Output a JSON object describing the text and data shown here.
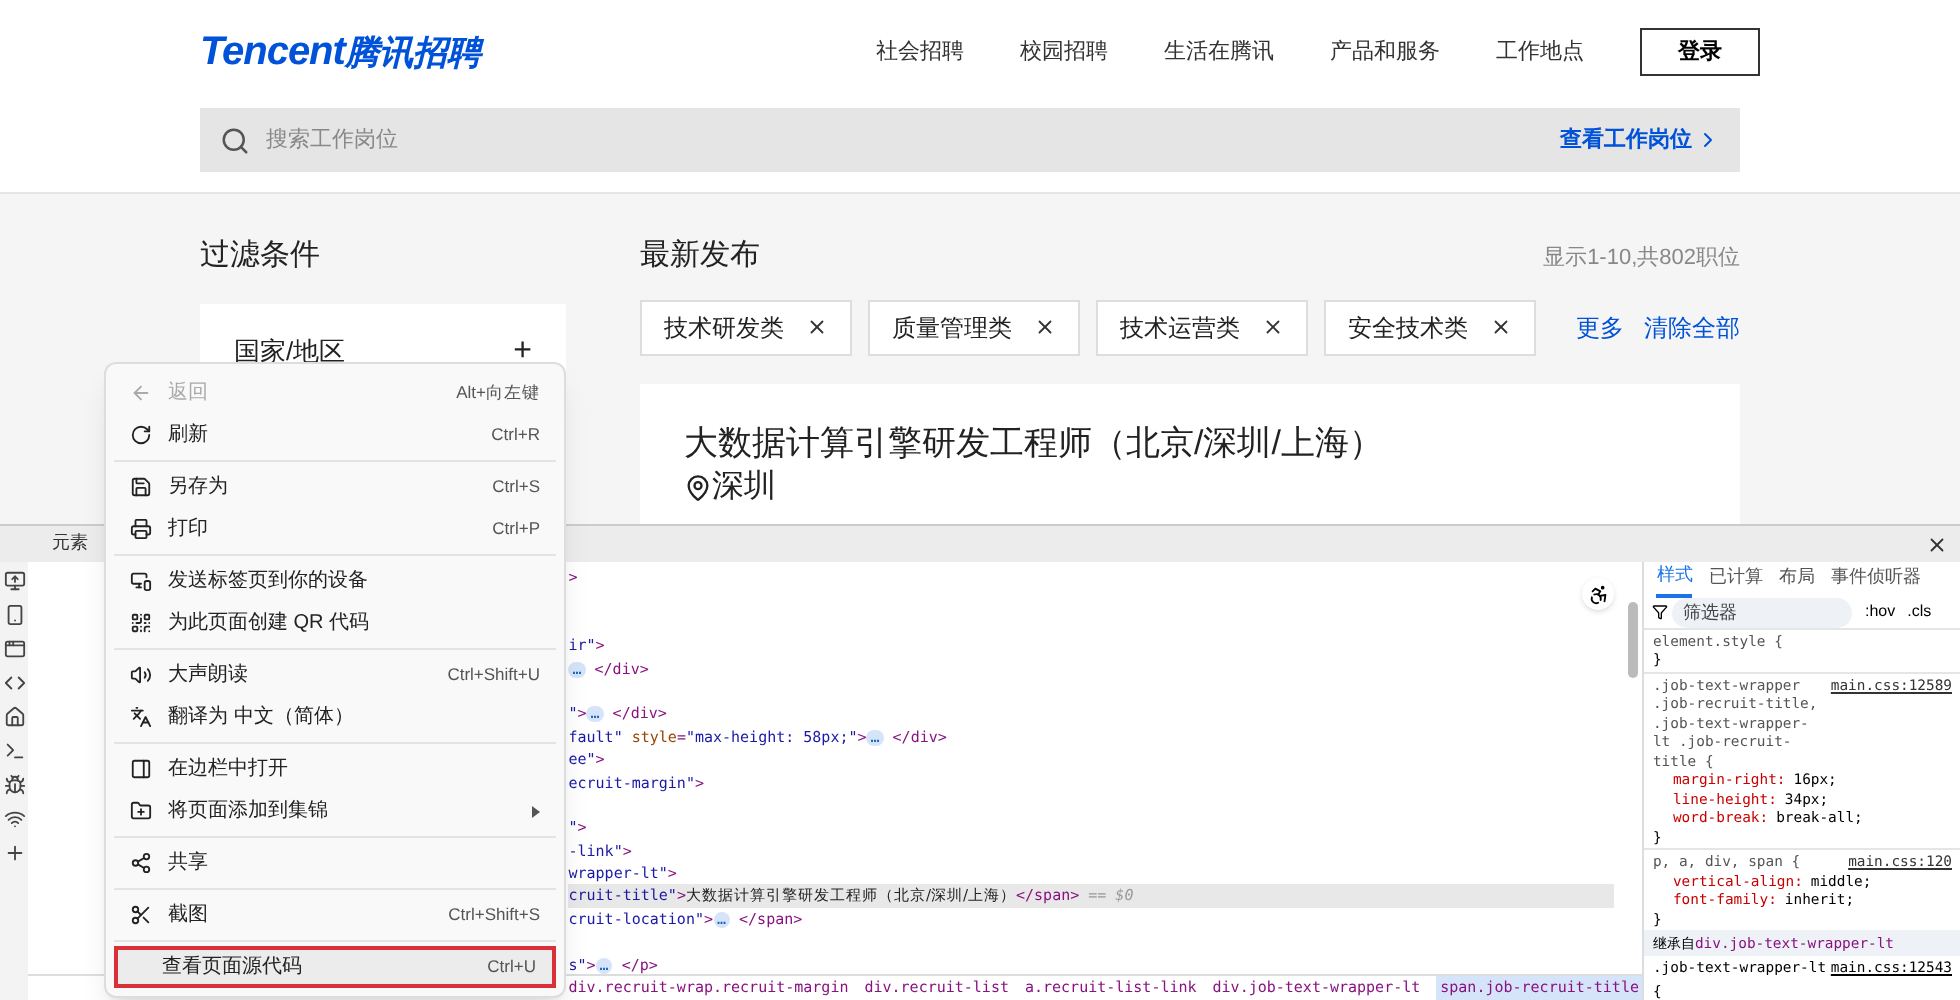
{
  "header": {
    "logo_latin": "Tencent",
    "logo_cn": "腾讯招聘",
    "nav": [
      "社会招聘",
      "校园招聘",
      "生活在腾讯",
      "产品和服务",
      "工作地点"
    ],
    "login": "登录",
    "search": {
      "placeholder": "搜索工作岗位",
      "action": "查看工作岗位"
    }
  },
  "filters": {
    "title": "过滤条件",
    "groups": [
      {
        "label": "国家/地区",
        "expand": "+"
      }
    ]
  },
  "latest": {
    "title": "最新发布",
    "count": "显示1-10,共802职位",
    "tags": [
      "技术研发类",
      "质量管理类",
      "技术运营类",
      "安全技术类"
    ],
    "more": "更多",
    "clear": "清除全部",
    "job": {
      "title": "大数据计算引擎研发工程师（北京/深圳/上海）",
      "location": "深圳"
    }
  },
  "devtools": {
    "tab": "元素",
    "code_lines": [
      {
        "selected": false,
        "parts": [
          {
            "kind": "tag",
            "text": ">"
          }
        ]
      },
      {
        "selected": false
      },
      {
        "selected": false
      },
      {
        "selected": false,
        "parts": [
          {
            "kind": "value",
            "text": "ir\""
          },
          {
            "kind": "tag",
            "text": ">"
          }
        ]
      },
      {
        "selected": false,
        "parts": [
          {
            "kind": "ellipsis",
            "text": "…"
          },
          {
            "kind": "tag",
            "text": " </div>"
          }
        ]
      },
      {
        "selected": false
      },
      {
        "selected": false,
        "parts": [
          {
            "kind": "value",
            "text": "\""
          },
          {
            "kind": "tag",
            "text": ">"
          },
          {
            "kind": "ellipsis",
            "text": "…"
          },
          {
            "kind": "tag",
            "text": " </div>"
          }
        ]
      },
      {
        "selected": false,
        "parts": [
          {
            "kind": "value",
            "text": "fault\""
          },
          {
            "kind": "attr",
            "text": " style"
          },
          {
            "kind": "tag",
            "text": "="
          },
          {
            "kind": "value",
            "text": "\"max-height: 58px;\""
          },
          {
            "kind": "tag",
            "text": ">"
          },
          {
            "kind": "ellipsis",
            "text": "…"
          },
          {
            "kind": "tag",
            "text": " </div>"
          }
        ]
      },
      {
        "selected": false,
        "parts": [
          {
            "kind": "value",
            "text": "ee\""
          },
          {
            "kind": "tag",
            "text": ">"
          }
        ]
      },
      {
        "selected": false,
        "parts": [
          {
            "kind": "value",
            "text": "ecruit-margin\""
          },
          {
            "kind": "tag",
            "text": ">"
          }
        ]
      },
      {
        "selected": false
      },
      {
        "selected": false,
        "parts": [
          {
            "kind": "value",
            "text": "\""
          },
          {
            "kind": "tag",
            "text": ">"
          }
        ]
      },
      {
        "selected": false,
        "parts": [
          {
            "kind": "value",
            "text": "-link\""
          },
          {
            "kind": "tag",
            "text": ">"
          }
        ]
      },
      {
        "selected": false,
        "parts": [
          {
            "kind": "value",
            "text": "wrapper-lt\""
          },
          {
            "kind": "tag",
            "text": ">"
          }
        ]
      },
      {
        "selected": true,
        "parts": [
          {
            "kind": "value",
            "text": "cruit-title\""
          },
          {
            "kind": "tag",
            "text": ">"
          },
          {
            "kind": "text",
            "text": "大数据计算引擎研发工程师（北京/深圳/上海）"
          },
          {
            "kind": "tag",
            "text": "</span>"
          },
          {
            "kind": "note",
            "text": " == $0"
          }
        ]
      },
      {
        "selected": false,
        "parts": [
          {
            "kind": "value",
            "text": "cruit-location\""
          },
          {
            "kind": "tag",
            "text": ">"
          },
          {
            "kind": "ellipsis",
            "text": "…"
          },
          {
            "kind": "tag",
            "text": " </span>"
          }
        ]
      },
      {
        "selected": false
      },
      {
        "selected": false,
        "parts": [
          {
            "kind": "value",
            "text": "s\""
          },
          {
            "kind": "tag",
            "text": ">"
          },
          {
            "kind": "ellipsis",
            "text": "…"
          },
          {
            "kind": "tag",
            "text": " </p>"
          }
        ]
      }
    ],
    "breadcrumbs": [
      {
        "label": "div.recruit-wrap.recruit-margin",
        "selected": false
      },
      {
        "label": "div.recruit-list",
        "selected": false
      },
      {
        "label": "a.recruit-list-link",
        "selected": false
      },
      {
        "label": "div.job-text-wrapper-lt",
        "selected": false
      },
      {
        "label": "span.job-recruit-title",
        "selected": true
      }
    ],
    "styles_tabs": [
      {
        "label": "样式",
        "selected": true
      },
      {
        "label": "已计算",
        "selected": false
      },
      {
        "label": "布局",
        "selected": false
      },
      {
        "label": "事件侦听器",
        "selected": false
      }
    ],
    "filter": {
      "placeholder": "筛选器",
      "hov": ":hov",
      "cls": ".cls"
    },
    "rules": [
      {
        "selector": "element.style {",
        "close": "}"
      },
      {
        "selector": ".job-text-wrapper .job-recruit-title, .job-text-wrapper-lt .job-recruit-title {",
        "source": "main.css:12589",
        "props": [
          {
            "name": "margin-right:",
            "value": "16px;"
          },
          {
            "name": "line-height:",
            "value": "34px;"
          },
          {
            "name": "word-break:",
            "value": "break-all;"
          }
        ],
        "close": "}"
      },
      {
        "selector": "p, a, div, span {",
        "source": "main.css:120",
        "props": [
          {
            "name": "vertical-align:",
            "value": "middle;"
          },
          {
            "name": "font-family:",
            "value": "inherit;"
          }
        ],
        "close": "}"
      }
    ],
    "inherited": {
      "label": "继承自",
      "selector": "div.job-text-wrapper-lt"
    },
    "last_rule": {
      "selector": ".job-text-wrapper-lt {",
      "source": "main.css:12543"
    }
  },
  "context_menu": [
    {
      "kind": "item",
      "label": "返回",
      "shortcut": "Alt+向左键",
      "disabled": true,
      "highlighted": false
    },
    {
      "kind": "item",
      "label": "刷新",
      "shortcut": "Ctrl+R",
      "disabled": false,
      "highlighted": false
    },
    {
      "kind": "divider"
    },
    {
      "kind": "item",
      "label": "另存为",
      "shortcut": "Ctrl+S",
      "disabled": false,
      "highlighted": false
    },
    {
      "kind": "item",
      "label": "打印",
      "shortcut": "Ctrl+P",
      "disabled": false,
      "highlighted": false
    },
    {
      "kind": "divider"
    },
    {
      "kind": "item",
      "label": "发送标签页到你的设备",
      "disabled": false,
      "highlighted": false
    },
    {
      "kind": "item",
      "label": "为此页面创建 QR 代码",
      "disabled": false,
      "highlighted": false
    },
    {
      "kind": "divider"
    },
    {
      "kind": "item",
      "label": "大声朗读",
      "shortcut": "Ctrl+Shift+U",
      "disabled": false,
      "highlighted": false
    },
    {
      "kind": "item",
      "label": "翻译为 中文（简体）",
      "disabled": false,
      "highlighted": false
    },
    {
      "kind": "divider"
    },
    {
      "kind": "item",
      "label": "在边栏中打开",
      "disabled": false,
      "highlighted": false
    },
    {
      "kind": "submenu",
      "label": "将页面添加到集锦",
      "disabled": false,
      "highlighted": false
    },
    {
      "kind": "divider"
    },
    {
      "kind": "item",
      "label": "共享",
      "disabled": false,
      "highlighted": false
    },
    {
      "kind": "divider"
    },
    {
      "kind": "item",
      "label": "截图",
      "shortcut": "Ctrl+Shift+S",
      "disabled": false,
      "highlighted": false
    },
    {
      "kind": "divider"
    },
    {
      "kind": "item",
      "label": "查看页面源代码",
      "shortcut": "Ctrl+U",
      "disabled": false,
      "highlighted": true
    }
  ]
}
